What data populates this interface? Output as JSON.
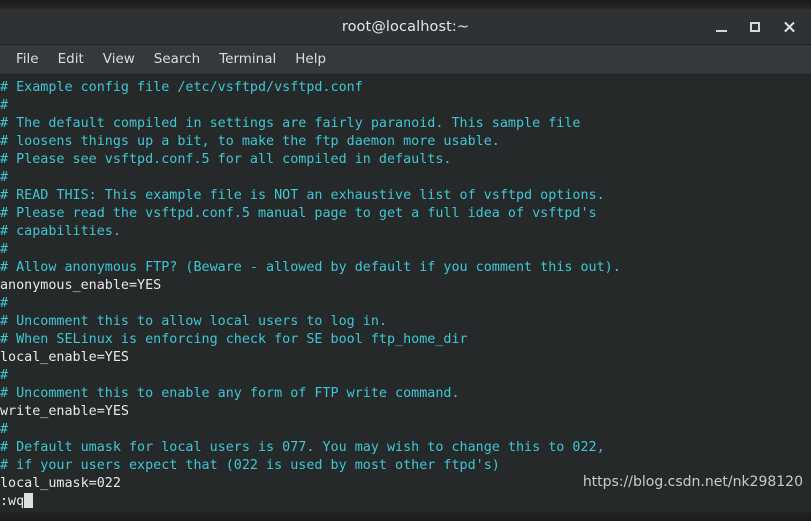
{
  "window": {
    "title": "root@localhost:~",
    "controls": {
      "minimize_label": "Minimize",
      "maximize_label": "Maximize",
      "close_label": "Close"
    }
  },
  "menubar": {
    "items": [
      {
        "label": "File"
      },
      {
        "label": "Edit"
      },
      {
        "label": "View"
      },
      {
        "label": "Search"
      },
      {
        "label": "Terminal"
      },
      {
        "label": "Help"
      }
    ]
  },
  "terminal": {
    "colors": {
      "background": "#26292a",
      "comment": "#3ec7d4",
      "plain": "#e9eaea",
      "cursor": "#dfe1e1"
    },
    "lines": [
      {
        "text": "# Example config file /etc/vsftpd/vsftpd.conf",
        "type": "comment"
      },
      {
        "text": "#",
        "type": "comment"
      },
      {
        "text": "# The default compiled in settings are fairly paranoid. This sample file",
        "type": "comment"
      },
      {
        "text": "# loosens things up a bit, to make the ftp daemon more usable.",
        "type": "comment"
      },
      {
        "text": "# Please see vsftpd.conf.5 for all compiled in defaults.",
        "type": "comment"
      },
      {
        "text": "#",
        "type": "comment"
      },
      {
        "text": "# READ THIS: This example file is NOT an exhaustive list of vsftpd options.",
        "type": "comment"
      },
      {
        "text": "# Please read the vsftpd.conf.5 manual page to get a full idea of vsftpd's",
        "type": "comment"
      },
      {
        "text": "# capabilities.",
        "type": "comment"
      },
      {
        "text": "#",
        "type": "comment"
      },
      {
        "text": "# Allow anonymous FTP? (Beware - allowed by default if you comment this out).",
        "type": "comment"
      },
      {
        "text": "anonymous_enable=YES",
        "type": "plain"
      },
      {
        "text": "#",
        "type": "comment"
      },
      {
        "text": "# Uncomment this to allow local users to log in.",
        "type": "comment"
      },
      {
        "text": "# When SELinux is enforcing check for SE bool ftp_home_dir",
        "type": "comment"
      },
      {
        "text": "local_enable=YES",
        "type": "plain"
      },
      {
        "text": "#",
        "type": "comment"
      },
      {
        "text": "# Uncomment this to enable any form of FTP write command.",
        "type": "comment"
      },
      {
        "text": "write_enable=YES",
        "type": "plain"
      },
      {
        "text": "#",
        "type": "comment"
      },
      {
        "text": "# Default umask for local users is 077. You may wish to change this to 022,",
        "type": "comment"
      },
      {
        "text": "# if your users expect that (022 is used by most other ftpd's)",
        "type": "comment"
      },
      {
        "text": "local_umask=022",
        "type": "plain"
      }
    ],
    "command_line": ":wq"
  },
  "watermark": {
    "text": "https://blog.csdn.net/nk298120"
  }
}
